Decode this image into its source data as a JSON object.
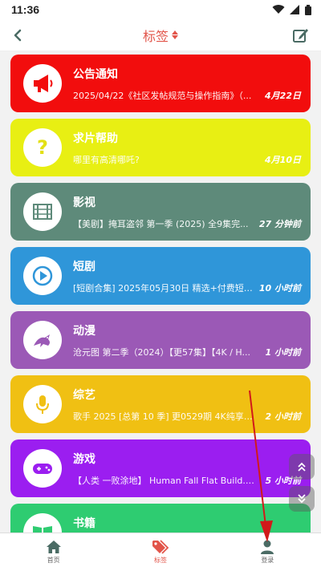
{
  "status_bar": {
    "time": "11:36",
    "icons": [
      "wifi-icon",
      "signal-icon",
      "battery-icon"
    ]
  },
  "header": {
    "title": "标签",
    "back_icon": "back-arrow-icon",
    "sort_icon": "sort-icon",
    "edit_icon": "edit-icon"
  },
  "cards": [
    {
      "name": "公告通知",
      "desc": "2025/04/22《社区发帖规范与操作指南》（...",
      "time": "4月22日",
      "color": "#f20d0d",
      "icon": "megaphone-icon",
      "icon_color": "#f20d0d"
    },
    {
      "name": "求片帮助",
      "desc": "哪里有高清哪吒?",
      "time": "4月10日",
      "color": "#e8ef13",
      "icon": "question-icon",
      "icon_color": "#e3e015"
    },
    {
      "name": "影视",
      "desc": "【美剧】掩耳盗邻 第一季 (2025) 全9集完...",
      "time": "27 分钟前",
      "color": "#5e8a7a",
      "icon": "film-icon",
      "icon_color": "#5e8a7a"
    },
    {
      "name": "短剧",
      "desc": "[短剧合集] 2025年05月30日 精选+付费短剧...",
      "time": "10 小时前",
      "color": "#2f96d9",
      "icon": "play-icon",
      "icon_color": "#2f96d9"
    },
    {
      "name": "动漫",
      "desc": "沧元图 第二季（2024）【更57集】【4K / H...",
      "time": "1 小时前",
      "color": "#9b59b6",
      "icon": "dragon-icon",
      "icon_color": "#9b59b6"
    },
    {
      "name": "综艺",
      "desc": "歌手 2025 [总第 10 季] 更0529期 4K纯享版...",
      "time": "2 小时前",
      "color": "#f0c013",
      "icon": "microphone-icon",
      "icon_color": "#f0c013"
    },
    {
      "name": "游戏",
      "desc": "【人类 一败涂地】 Human Fall Flat Build.1...",
      "time": "5 小时前",
      "color": "#9b1ef0",
      "icon": "gamepad-icon",
      "icon_color": "#9b1ef0"
    },
    {
      "name": "书籍",
      "desc": "",
      "time": "",
      "color": "#2ecc71",
      "icon": "book-icon",
      "icon_color": "#2ecc71"
    }
  ],
  "bottom_nav": [
    {
      "label": "首页",
      "icon": "home-icon",
      "active": false
    },
    {
      "label": "标签",
      "icon": "tag-icon",
      "active": true
    },
    {
      "label": "登录",
      "icon": "user-icon",
      "active": false
    }
  ],
  "floating_buttons": [
    "scroll-top-icon",
    "scroll-bottom-icon"
  ],
  "colors": {
    "accent": "#e2554a",
    "annotation": "#d11a1a"
  }
}
